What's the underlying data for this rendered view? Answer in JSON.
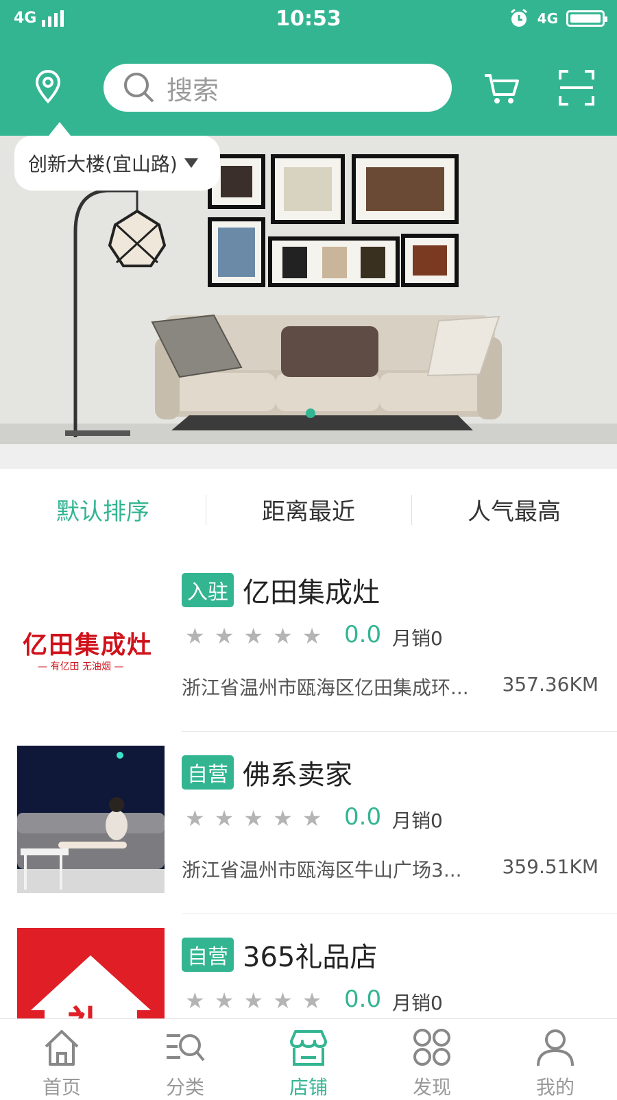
{
  "status_bar": {
    "network_left": "4G",
    "time": "10:53",
    "network_right": "4G",
    "icons": [
      "signal-icon",
      "alarm-icon",
      "battery-icon"
    ]
  },
  "header": {
    "location_icon": "location-pin-icon",
    "search_placeholder": "搜索",
    "cart_icon": "cart-icon",
    "scan_icon": "scan-icon",
    "location_label": "创新大楼(宜山路)"
  },
  "banner": {
    "image": "living-room-sofa-photo",
    "active_dot": 1,
    "dot_count": 1
  },
  "sort_options": [
    {
      "label": "默认排序",
      "active": true
    },
    {
      "label": "距离最近",
      "active": false
    },
    {
      "label": "人气最高",
      "active": false
    }
  ],
  "stores": [
    {
      "tag": "入驻",
      "name": "亿田集成灶",
      "rating": "0.0",
      "monthly_sales": "月销0",
      "address": "浙江省温州市瓯海区亿田集成环...",
      "distance": "357.36KM",
      "logo_text": "亿田集成灶",
      "logo_sub": "— 有亿田 无油烟 —"
    },
    {
      "tag": "自营",
      "name": "佛系卖家",
      "rating": "0.0",
      "monthly_sales": "月销0",
      "address": "浙江省温州市瓯海区牛山广场3...",
      "distance": "359.51KM"
    },
    {
      "tag": "自营",
      "name": "365礼品店",
      "rating": "0.0",
      "monthly_sales": "月销0",
      "address": "",
      "distance": "",
      "logo_text": "礼"
    }
  ],
  "tabs": [
    {
      "label": "首页",
      "icon": "home-icon",
      "active": false
    },
    {
      "label": "分类",
      "icon": "category-icon",
      "active": false
    },
    {
      "label": "店铺",
      "icon": "store-icon",
      "active": true
    },
    {
      "label": "发现",
      "icon": "discover-icon",
      "active": false
    },
    {
      "label": "我的",
      "icon": "profile-icon",
      "active": false
    }
  ],
  "colors": {
    "brand": "#33b592",
    "star": "#b4b4b4"
  }
}
